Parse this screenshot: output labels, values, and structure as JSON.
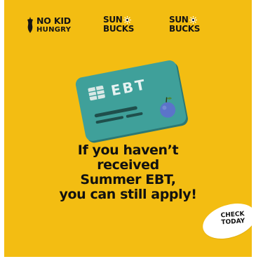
{
  "logos": {
    "nokid": {
      "line1": "NO KID",
      "line2": "HUNGRY"
    },
    "sunbucks_1": {
      "line1": "SUN",
      "line2": "BUCKS"
    },
    "sunbucks_2": {
      "line1": "SUN",
      "line2": "BUCKS"
    }
  },
  "card": {
    "label": "EBT"
  },
  "headline": {
    "line1": "If you haven’t",
    "line2": "received",
    "line3": "Summer EBT,",
    "line4": "you can still apply!"
  },
  "cta": {
    "line1": "CHECK",
    "line2": "TODAY"
  },
  "colors": {
    "background": "#F3BD12",
    "card": "#3FA09A",
    "card_dark": "#2C7874",
    "text": "#141414",
    "badge": "#FFFFFF",
    "fruit": "#5B74C9"
  }
}
